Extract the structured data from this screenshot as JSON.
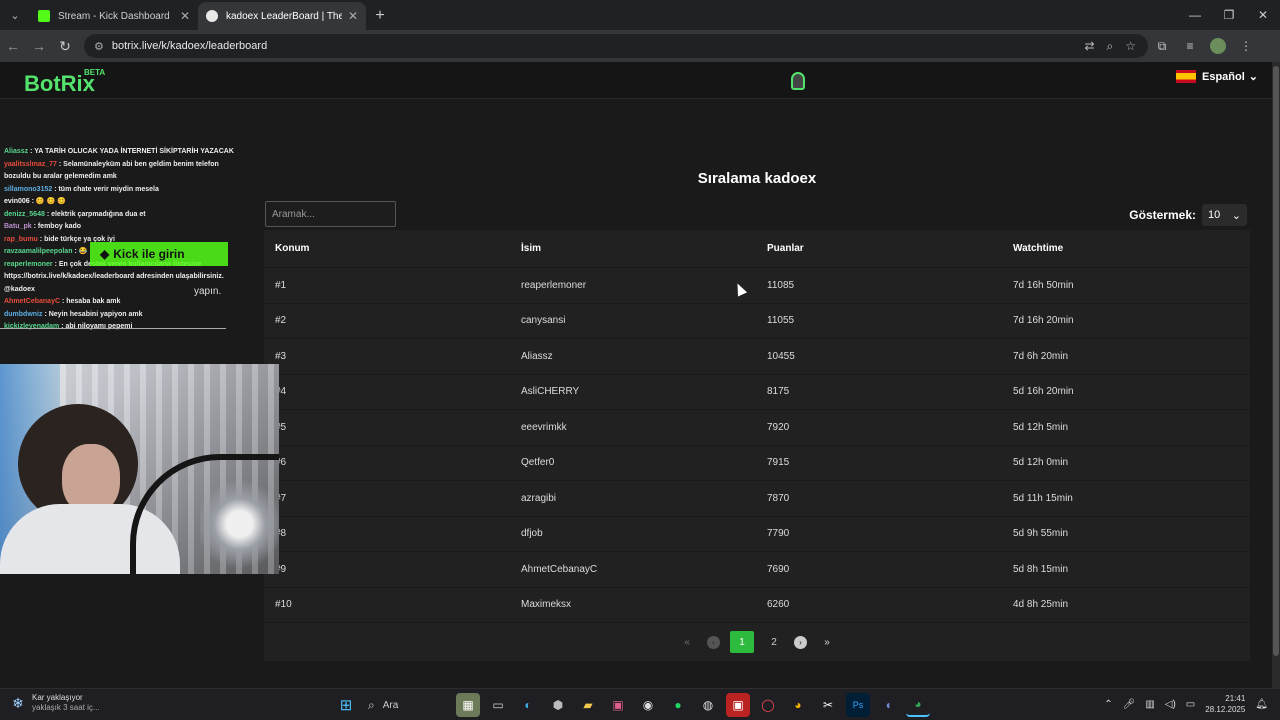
{
  "browser": {
    "tabs": [
      {
        "title": "Stream - Kick Dashboard",
        "favicon_color": "#53fc18",
        "active": false
      },
      {
        "title": "kadoex LeaderBoard | The best",
        "favicon_color": "#e8e8e8",
        "active": true
      }
    ],
    "new_tab": "+",
    "url": "botrix.live/k/kadoex/leaderboard",
    "window_controls": {
      "minimize": "—",
      "restore": "❐",
      "close": "✕"
    }
  },
  "site": {
    "logo": "BotRix",
    "logo_badge": "BETA",
    "language": "Español",
    "heading": "Sıralama kadoex",
    "search_placeholder": "Aramak...",
    "show_label": "Göstermek:",
    "show_value": "10"
  },
  "table": {
    "columns": [
      "Konum",
      "İsim",
      "Puanlar",
      "Watchtime"
    ],
    "rows": [
      [
        "#1",
        "reaperlemoner",
        "11085",
        "7d 16h 50min"
      ],
      [
        "#2",
        "canysansi",
        "11055",
        "7d 16h 20min"
      ],
      [
        "#3",
        "Aliassz",
        "10455",
        "7d 6h 20min"
      ],
      [
        "#4",
        "AsliCHERRY",
        "8175",
        "5d 16h 20min"
      ],
      [
        "#5",
        "eeevrimkk",
        "7920",
        "5d 12h 5min"
      ],
      [
        "#6",
        "Qetfer0",
        "7915",
        "5d 12h 0min"
      ],
      [
        "#7",
        "azragibi",
        "7870",
        "5d 11h 15min"
      ],
      [
        "#8",
        "dfjob",
        "7790",
        "5d 9h 55min"
      ],
      [
        "#9",
        "AhmetCebanayC",
        "7690",
        "5d 8h 15min"
      ],
      [
        "#10",
        "Maximeksx",
        "6260",
        "4d 8h 25min"
      ]
    ]
  },
  "pagination": {
    "first": "«",
    "prev": "‹",
    "pages": [
      "1",
      "2"
    ],
    "current": "1",
    "next": "›",
    "last": "»"
  },
  "overlay": {
    "chat": [
      {
        "user": "Aliassz",
        "color": "#58d68d",
        "text": ": YA TARİH OLUCAK YADA İNTERNETİ SİKİPTARİH YAZACAK"
      },
      {
        "user": "yaalitsslmaz_77",
        "color": "#e74c3c",
        "text": ": Selamünaleyküm abi ben geldim benim telefon bozuldu bu aralar gelemedim amk"
      },
      {
        "user": "sillamono3152",
        "color": "#5dade2",
        "text": ": tüm chate verir miydin mesela"
      },
      {
        "user": "evin006",
        "color": "#f5f5f5",
        "text": ": 😊 😊 😊"
      },
      {
        "user": "denizz_5648",
        "color": "#58d68d",
        "text": ": elektrik çarpmadığına dua et"
      },
      {
        "user": "Batu_pk",
        "color": "#bb8fce",
        "text": ": femboy kado"
      },
      {
        "user": "rap_bumu",
        "color": "#e74c3c",
        "text": ": bide türkçe ya çok iyi"
      },
      {
        "user": "ravzaamalilpeepolan",
        "color": "#58d68d",
        "text": ": 😂"
      },
      {
        "user": "reaperlemoner",
        "color": "#58d68d",
        "text": ": En çok destek veren kullanıcıların listesine https://botrix.live/k/kadoex/leaderboard adresinden ulaşabilirsiniz. @kadoex"
      },
      {
        "user": "AhmetCebanayC",
        "color": "#e74c3c",
        "text": ": hesaba bak amk"
      },
      {
        "user": "dumbdwniz",
        "color": "#5dade2",
        "text": ": Neyin hesabini yapiyon amk"
      },
      {
        "user": "kickizleyenadam",
        "color": "#58d68d",
        "text": ": abi niloyamı pepemi"
      }
    ],
    "login_button": "Kick ile girin",
    "login_suffix": "yapın."
  },
  "taskbar": {
    "weather_title": "Kar yaklaşıyor",
    "weather_sub": "yaklaşık 3 saat iç...",
    "search": "Ara",
    "time": "21:41",
    "date": "28.12.2025"
  }
}
